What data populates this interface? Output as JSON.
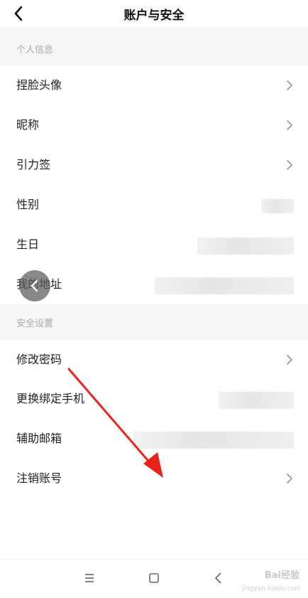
{
  "header": {
    "title": "账户与安全",
    "back_icon": "chevron-left-icon"
  },
  "sections": [
    {
      "title": "个人信息",
      "items": [
        {
          "label": "捏脸头像",
          "value": "",
          "has_chevron": true
        },
        {
          "label": "昵称",
          "value": "",
          "has_chevron": true
        },
        {
          "label": "引力签",
          "value": "",
          "has_chevron": true
        },
        {
          "label": "性别",
          "value": "",
          "has_chevron": false
        },
        {
          "label": "生日",
          "value": "",
          "has_chevron": false
        },
        {
          "label": "我的地址",
          "value": "",
          "has_chevron": false
        }
      ]
    },
    {
      "title": "安全设置",
      "items": [
        {
          "label": "修改密码",
          "value": "",
          "has_chevron": true
        },
        {
          "label": "更换绑定手机",
          "value": "",
          "has_chevron": false
        },
        {
          "label": "辅助邮箱",
          "value": "",
          "has_chevron": false
        },
        {
          "label": "注销账号",
          "value": "",
          "has_chevron": true
        }
      ]
    }
  ],
  "nav_bar": {
    "icons": [
      "menu-icon",
      "home-square-icon",
      "back-triangle-icon"
    ]
  },
  "watermark": {
    "brand": "Bai经验",
    "url": "jingyan.baidu.com"
  },
  "colors": {
    "section_bg": "#f6f6f6",
    "section_text": "#a9a9a9",
    "annotation_arrow": "#e8231c"
  }
}
